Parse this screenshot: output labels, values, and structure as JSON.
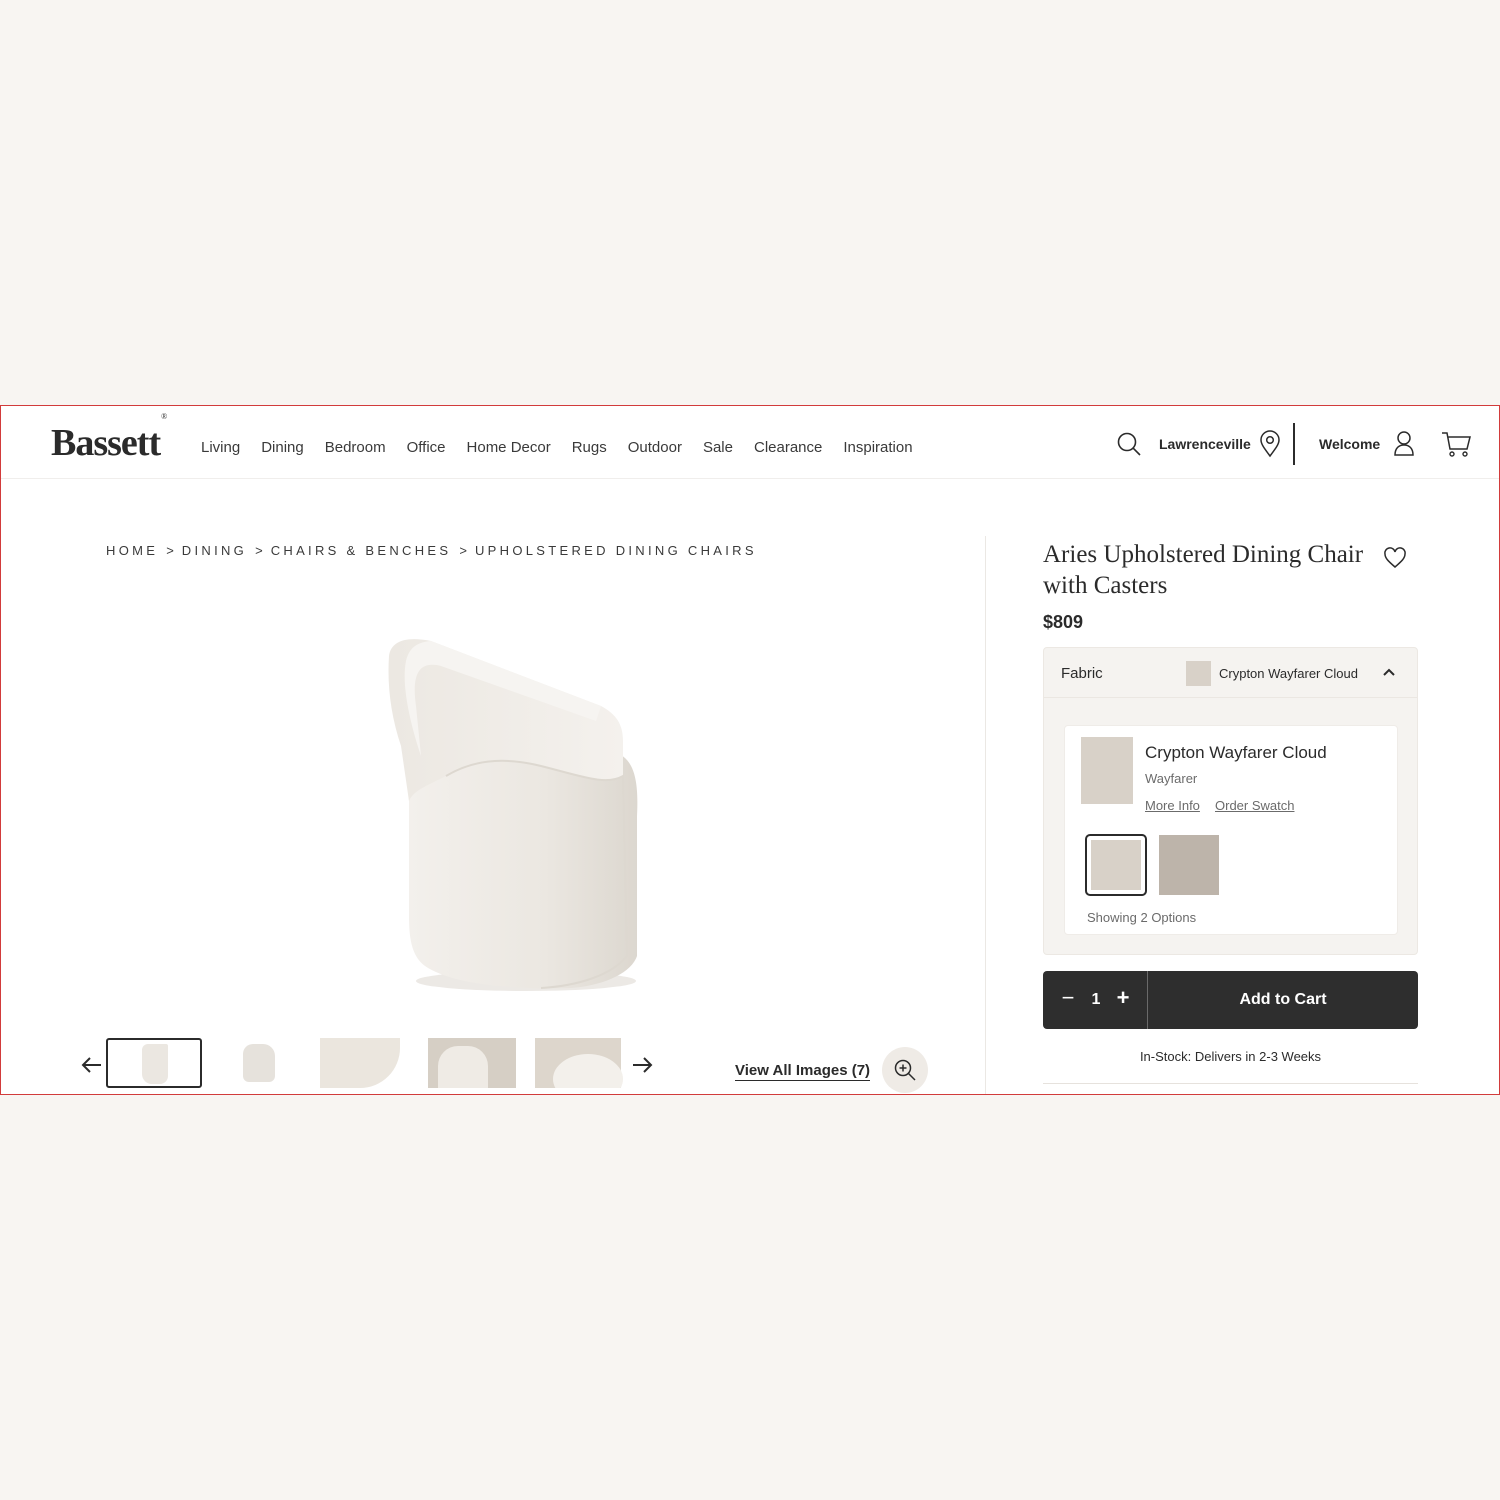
{
  "brand": {
    "logo": "Bassett",
    "reg_mark": "®"
  },
  "nav": [
    "Living",
    "Dining",
    "Bedroom",
    "Office",
    "Home Decor",
    "Rugs",
    "Outdoor",
    "Sale",
    "Clearance",
    "Inspiration"
  ],
  "header": {
    "location": "Lawrenceville",
    "welcome": "Welcome"
  },
  "breadcrumb": [
    "HOME",
    "DINING",
    "CHAIRS & BENCHES",
    "UPHOLSTERED DINING CHAIRS"
  ],
  "breadcrumb_sep": ">",
  "gallery": {
    "view_all": "View All Images (7)"
  },
  "product": {
    "title": "Aries Upholstered Dining Chair with Casters",
    "price": "$809"
  },
  "fabric": {
    "label": "Fabric",
    "selected": "Crypton Wayfarer Cloud",
    "card": {
      "name": "Crypton Wayfarer Cloud",
      "collection": "Wayfarer",
      "more_info": "More Info",
      "order_swatch": "Order Swatch",
      "count": "Showing 2 Options"
    },
    "options": [
      {
        "name": "Crypton Wayfarer Cloud",
        "color": "#d8d1c8"
      },
      {
        "name": "option-2",
        "color": "#bdb4aa"
      }
    ]
  },
  "cart": {
    "quantity": "1",
    "minus": "−",
    "plus": "+",
    "add_to_cart": "Add to Cart"
  },
  "stock": "In-Stock: Delivers in 2-3 Weeks",
  "colors": {
    "dark": "#2e2e2e",
    "fabric_cloud": "#d8d1c8",
    "fabric_alt": "#bdb4aa",
    "frame_border": "#d23b3b"
  }
}
